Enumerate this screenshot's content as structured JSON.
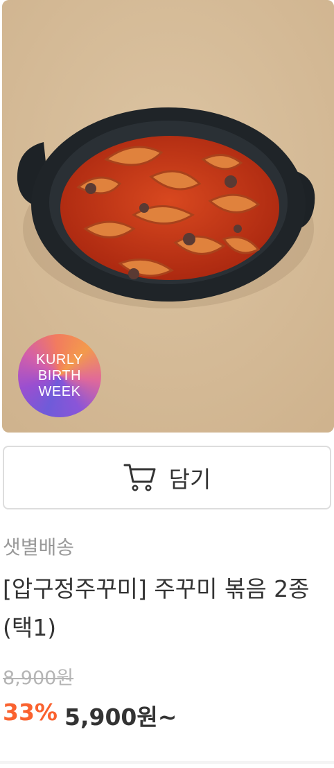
{
  "product": {
    "badge_lines": [
      "KURLY",
      "BIRTH",
      "WEEK"
    ],
    "cart_button_label": "담기",
    "delivery_type": "샛별배송",
    "title": "[압구정주꾸미] 주꾸미 볶음 2종 (택1)",
    "original_price": "8,900원",
    "discount_rate": "33%",
    "sale_price": "5,900원~"
  },
  "icons": {
    "cart": "cart-icon"
  },
  "colors": {
    "discount": "#fa622f",
    "text_primary": "#333333",
    "text_secondary": "#999999",
    "strikethrough": "#b5b5b5",
    "button_border": "#dddddd"
  }
}
